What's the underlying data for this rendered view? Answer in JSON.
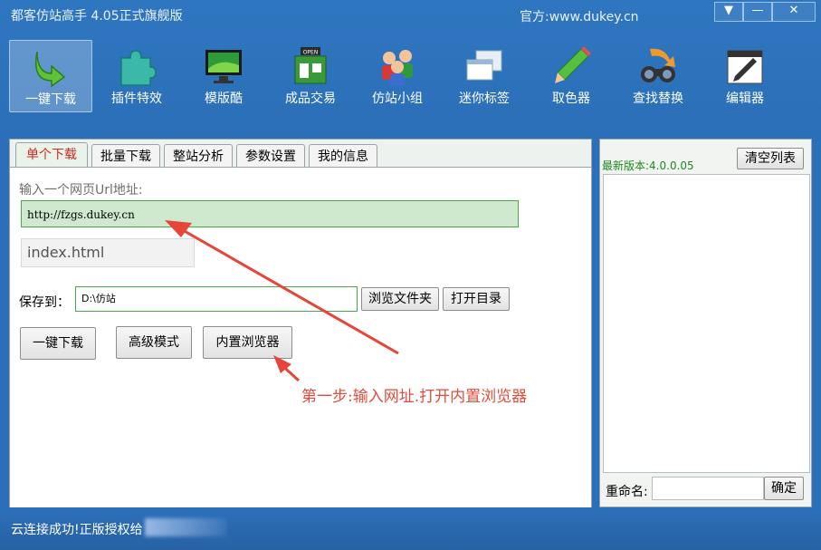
{
  "window": {
    "title": "都客仿站高手 4.05正式旗舰版",
    "site": "官方:www.dukey.cn",
    "controls": {
      "menu": "▼",
      "minimize": "—",
      "close": "✕"
    }
  },
  "toolbar": {
    "items": [
      {
        "label": "一键下载",
        "icon": "download-arrow-icon"
      },
      {
        "label": "插件特效",
        "icon": "puzzle-icon"
      },
      {
        "label": "模版酷",
        "icon": "monitor-icon"
      },
      {
        "label": "成品交易",
        "icon": "shop-icon"
      },
      {
        "label": "仿站小组",
        "icon": "users-icon"
      },
      {
        "label": "迷你标签",
        "icon": "window-tabs-icon"
      },
      {
        "label": "取色器",
        "icon": "pencil-icon"
      },
      {
        "label": "查找替换",
        "icon": "binoculars-icon"
      },
      {
        "label": "编辑器",
        "icon": "notepad-icon"
      }
    ]
  },
  "tabs": [
    {
      "label": "单个下载"
    },
    {
      "label": "批量下载"
    },
    {
      "label": "整站分析"
    },
    {
      "label": "参数设置"
    },
    {
      "label": "我的信息"
    }
  ],
  "form": {
    "url_label": "输入一个网页Url地址:",
    "url_value": "http://fzgs.dukey.cn",
    "filename_value": "index.html",
    "save_label": "保存到：",
    "save_path": "D:\\仿站",
    "browse_button": "浏览文件夹",
    "open_dir_button": "打开目录",
    "download_button": "一键下载",
    "advanced_button": "高级模式",
    "browser_button": "内置浏览器"
  },
  "annotation": "第一步:输入网址.打开内置浏览器",
  "right_panel": {
    "version": "最新版本:4.0.0.05",
    "clear_button": "清空列表",
    "rename_label": "重命名:",
    "confirm_button": "确定"
  },
  "status": {
    "text": "云连接成功!正版授权给"
  },
  "colors": {
    "accent_blue": "#2b6fb8",
    "active_tab_text": "#d0281e",
    "annotation_red": "#e24c3c",
    "input_green": "#cfe9cf"
  }
}
